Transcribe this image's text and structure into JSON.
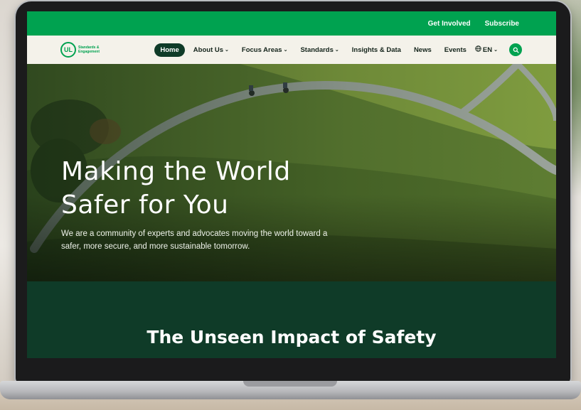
{
  "topbar": {
    "links": [
      "Get Involved",
      "Subscribe"
    ]
  },
  "logo": {
    "mark": "UL",
    "text_line1": "Standards &",
    "text_line2": "Engagement"
  },
  "nav": {
    "items": [
      {
        "label": "Home",
        "active": true,
        "dropdown": false
      },
      {
        "label": "About Us",
        "active": false,
        "dropdown": true
      },
      {
        "label": "Focus Areas",
        "active": false,
        "dropdown": true
      },
      {
        "label": "Standards",
        "active": false,
        "dropdown": true
      },
      {
        "label": "Insights & Data",
        "active": false,
        "dropdown": false
      },
      {
        "label": "News",
        "active": false,
        "dropdown": false
      },
      {
        "label": "Events",
        "active": false,
        "dropdown": false
      }
    ],
    "language": "EN",
    "icons": [
      "globe-icon",
      "chevron-down-icon",
      "search-icon"
    ]
  },
  "hero": {
    "title_line1": "Making the World",
    "title_line2": "Safer for You",
    "subtitle": "We are a community of experts and advocates moving the world toward a safer, more secure, and more sustainable tomorrow."
  },
  "section": {
    "title": "The Unseen Impact of Safety"
  },
  "colors": {
    "brand_green": "#00a250",
    "dark_green": "#0f3b28",
    "nav_bg": "#f4f2ea"
  }
}
